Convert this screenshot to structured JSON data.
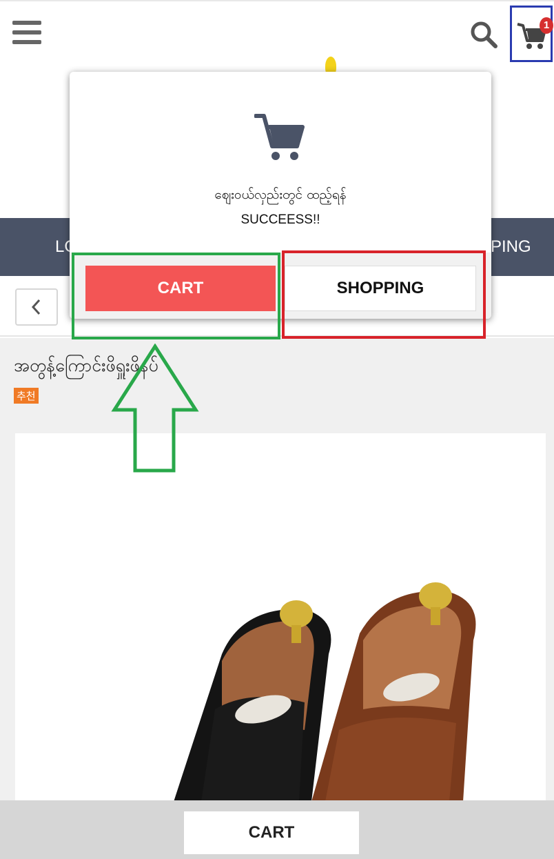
{
  "header": {
    "menu_icon": "hamburger-menu-icon",
    "search_icon": "search-icon",
    "cart_icon": "cart-icon",
    "cart_count": "1"
  },
  "nav": {
    "left_fragment": "LO",
    "right_fragment": "PING"
  },
  "product": {
    "title": "အတွန့်ကြောင်းဖိရှူးဖိနပ်",
    "badge": "추천"
  },
  "modal": {
    "icon": "cart-icon",
    "message": "ဈေးဝယ်လှည်းတွင် ထည့်ရန်",
    "status": "SUCCEESS!!",
    "cart_button": "CART",
    "shopping_button": "SHOPPING"
  },
  "bottom": {
    "cart_button": "CART"
  },
  "colors": {
    "nav_bg": "#4a5367",
    "cart_btn": "#f35555",
    "badge": "#f07a25",
    "highlight_green": "#29a84a",
    "highlight_red": "#d8232a",
    "highlight_blue": "#2a3bb0"
  }
}
